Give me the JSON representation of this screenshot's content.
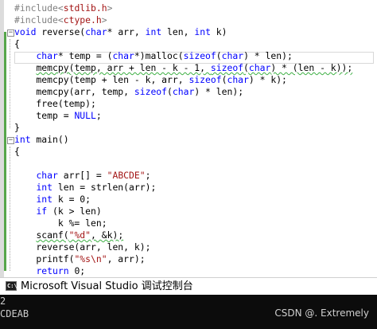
{
  "editor": {
    "lines": [
      [
        {
          "t": "#include<",
          "c": "inc"
        },
        {
          "t": "stdlib.h",
          "c": "hdr"
        },
        {
          "t": ">",
          "c": "inc"
        }
      ],
      [
        {
          "t": "#include<",
          "c": "inc"
        },
        {
          "t": "ctype.h",
          "c": "hdr"
        },
        {
          "t": ">",
          "c": "inc"
        }
      ],
      [
        {
          "t": "void",
          "c": "kw"
        },
        {
          "t": " reverse(",
          "c": ""
        },
        {
          "t": "char",
          "c": "kw"
        },
        {
          "t": "* arr, ",
          "c": ""
        },
        {
          "t": "int",
          "c": "kw"
        },
        {
          "t": " len, ",
          "c": ""
        },
        {
          "t": "int",
          "c": "kw"
        },
        {
          "t": " k)",
          "c": ""
        }
      ],
      [
        {
          "t": "{",
          "c": ""
        }
      ],
      [
        {
          "t": "    ",
          "c": ""
        },
        {
          "t": "char",
          "c": "kw"
        },
        {
          "t": "* temp = (",
          "c": ""
        },
        {
          "t": "char",
          "c": "kw"
        },
        {
          "t": "*)malloc(",
          "c": ""
        },
        {
          "t": "sizeof",
          "c": "kw"
        },
        {
          "t": "(",
          "c": ""
        },
        {
          "t": "char",
          "c": "kw"
        },
        {
          "t": ") * len);",
          "c": ""
        }
      ],
      [
        {
          "t": "    ",
          "c": ""
        },
        {
          "t": "memcpy(temp, arr + len - k - 1, ",
          "c": "sq"
        },
        {
          "t": "sizeof",
          "c": "kw sq"
        },
        {
          "t": "(",
          "c": "sq"
        },
        {
          "t": "char",
          "c": "kw sq"
        },
        {
          "t": ") * (len - k));",
          "c": "sq"
        }
      ],
      [
        {
          "t": "    memcpy(temp + len - k, arr, ",
          "c": ""
        },
        {
          "t": "sizeof",
          "c": "kw"
        },
        {
          "t": "(",
          "c": ""
        },
        {
          "t": "char",
          "c": "kw"
        },
        {
          "t": ") * k);",
          "c": ""
        }
      ],
      [
        {
          "t": "    memcpy(arr, temp, ",
          "c": ""
        },
        {
          "t": "sizeof",
          "c": "kw"
        },
        {
          "t": "(",
          "c": ""
        },
        {
          "t": "char",
          "c": "kw"
        },
        {
          "t": ") * len);",
          "c": ""
        }
      ],
      [
        {
          "t": "    free(temp);",
          "c": ""
        }
      ],
      [
        {
          "t": "    temp = ",
          "c": ""
        },
        {
          "t": "NULL",
          "c": "kw"
        },
        {
          "t": ";",
          "c": ""
        }
      ],
      [
        {
          "t": "}",
          "c": ""
        }
      ],
      [
        {
          "t": "int",
          "c": "kw"
        },
        {
          "t": " main()",
          "c": ""
        }
      ],
      [
        {
          "t": "{",
          "c": ""
        }
      ],
      [
        {
          "t": "",
          "c": ""
        }
      ],
      [
        {
          "t": "    ",
          "c": ""
        },
        {
          "t": "char",
          "c": "kw"
        },
        {
          "t": " arr[] = ",
          "c": ""
        },
        {
          "t": "\"ABCDE\"",
          "c": "str"
        },
        {
          "t": ";",
          "c": ""
        }
      ],
      [
        {
          "t": "    ",
          "c": ""
        },
        {
          "t": "int",
          "c": "kw"
        },
        {
          "t": " len = strlen(arr);",
          "c": ""
        }
      ],
      [
        {
          "t": "    ",
          "c": ""
        },
        {
          "t": "int",
          "c": "kw"
        },
        {
          "t": " k = 0;",
          "c": ""
        }
      ],
      [
        {
          "t": "    ",
          "c": ""
        },
        {
          "t": "if",
          "c": "kw"
        },
        {
          "t": " (k > len)",
          "c": ""
        }
      ],
      [
        {
          "t": "        k %= len;",
          "c": ""
        }
      ],
      [
        {
          "t": "    ",
          "c": ""
        },
        {
          "t": "scanf(",
          "c": "sq"
        },
        {
          "t": "\"%d\"",
          "c": "str sq"
        },
        {
          "t": ", &k);",
          "c": "sq"
        }
      ],
      [
        {
          "t": "    reverse(arr, len, k);",
          "c": ""
        }
      ],
      [
        {
          "t": "    printf(",
          "c": ""
        },
        {
          "t": "\"%s\\n\"",
          "c": "str"
        },
        {
          "t": ", arr);",
          "c": ""
        }
      ],
      [
        {
          "t": "    ",
          "c": ""
        },
        {
          "t": "return",
          "c": "kw"
        },
        {
          "t": " 0;",
          "c": ""
        }
      ],
      [
        {
          "t": "}",
          "c": ""
        }
      ]
    ],
    "fold_markers": [
      "−",
      "−"
    ]
  },
  "console": {
    "title": "Microsoft Visual Studio 调试控制台",
    "icon": "console-window-icon",
    "icon_text": "C:\\",
    "output_lines": [
      "2",
      "CDEAB"
    ],
    "watermark": "CSDN @. Extremely"
  },
  "colors": {
    "keyword": "#0000ff",
    "string": "#a31515",
    "preprocessor": "#808080",
    "change_bar": "#57a64a",
    "squiggle": "#3cb043",
    "console_bg": "#0c0c0c"
  }
}
